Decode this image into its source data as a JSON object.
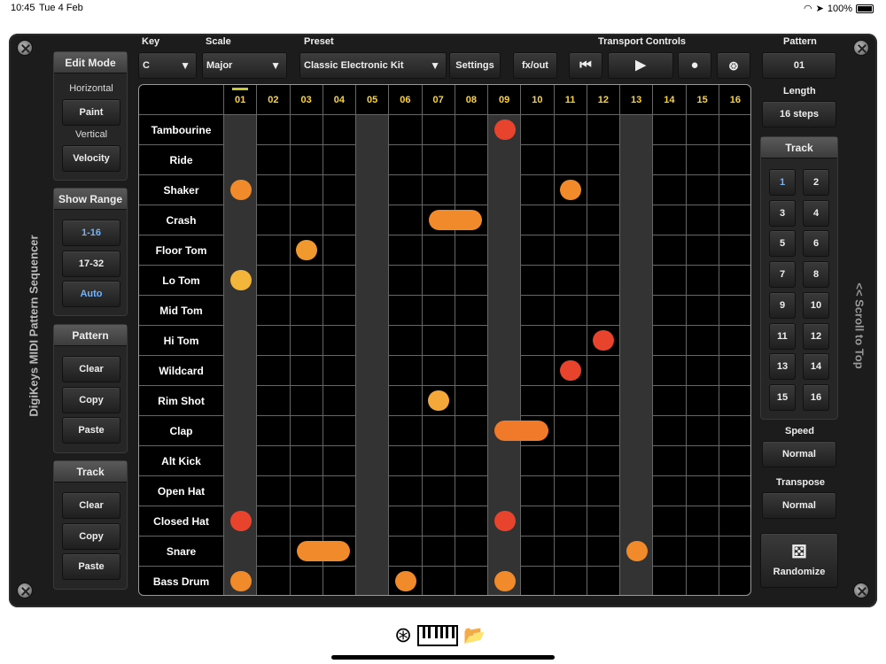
{
  "status": {
    "time": "10:45",
    "date": "Tue 4 Feb",
    "battery": "100%"
  },
  "app_title": "DigiKeys MIDI Pattern Sequencer",
  "scroll_hint": "<< Scroll to Top",
  "header": {
    "key_label": "Key",
    "key_value": "C",
    "scale_label": "Scale",
    "scale_value": "Major",
    "preset_label": "Preset",
    "preset_value": "Classic Electronic Kit",
    "settings": "Settings",
    "fxout": "fx/out",
    "transport_label": "Transport Controls",
    "pattern_label": "Pattern",
    "pattern_value": "01"
  },
  "left": {
    "edit_mode": {
      "title": "Edit Mode",
      "horizontal": "Horizontal",
      "paint": "Paint",
      "vertical": "Vertical",
      "velocity": "Velocity"
    },
    "show_range": {
      "title": "Show Range",
      "r1": "1-16",
      "r2": "17-32",
      "auto": "Auto"
    },
    "pattern": {
      "title": "Pattern",
      "clear": "Clear",
      "copy": "Copy",
      "paste": "Paste"
    },
    "track": {
      "title": "Track",
      "clear": "Clear",
      "copy": "Copy",
      "paste": "Paste"
    }
  },
  "right": {
    "length_label": "Length",
    "length_value": "16 steps",
    "track_title": "Track",
    "tracks": [
      "1",
      "2",
      "3",
      "4",
      "5",
      "6",
      "7",
      "8",
      "9",
      "10",
      "11",
      "12",
      "13",
      "14",
      "15",
      "16"
    ],
    "speed_label": "Speed",
    "speed_value": "Normal",
    "transpose_label": "Transpose",
    "transpose_value": "Normal",
    "randomize": "Randomize"
  },
  "columns": [
    "01",
    "02",
    "03",
    "04",
    "05",
    "06",
    "07",
    "08",
    "09",
    "10",
    "11",
    "12",
    "13",
    "14",
    "15",
    "16"
  ],
  "rows": [
    "Tambourine",
    "Ride",
    "Shaker",
    "Crash",
    "Floor Tom",
    "Lo Tom",
    "Mid Tom",
    "Hi Tom",
    "Wildcard",
    "Rim Shot",
    "Clap",
    "Alt Kick",
    "Open Hat",
    "Closed Hat",
    "Snare",
    "Bass Drum"
  ],
  "notes": [
    {
      "row": 0,
      "step": 9,
      "len": 1,
      "color": "#e8432c"
    },
    {
      "row": 2,
      "step": 1,
      "len": 1,
      "color": "#f08a2a"
    },
    {
      "row": 2,
      "step": 11,
      "len": 1,
      "color": "#f08a2a"
    },
    {
      "row": 3,
      "step": 7,
      "len": 2,
      "color": "#f08a2a"
    },
    {
      "row": 4,
      "step": 3,
      "len": 1,
      "color": "#f0992e"
    },
    {
      "row": 5,
      "step": 1,
      "len": 1,
      "color": "#f4b63a"
    },
    {
      "row": 7,
      "step": 12,
      "len": 1,
      "color": "#e8432c"
    },
    {
      "row": 8,
      "step": 11,
      "len": 1,
      "color": "#e8432c"
    },
    {
      "row": 9,
      "step": 7,
      "len": 1,
      "color": "#f4a83a"
    },
    {
      "row": 10,
      "step": 9,
      "len": 2,
      "color": "#f07a2a"
    },
    {
      "row": 13,
      "step": 1,
      "len": 1,
      "color": "#e8432c"
    },
    {
      "row": 13,
      "step": 9,
      "len": 1,
      "color": "#e8432c"
    },
    {
      "row": 14,
      "step": 3,
      "len": 2,
      "color": "#f08a2a"
    },
    {
      "row": 14,
      "step": 13,
      "len": 1,
      "color": "#f08a2a"
    },
    {
      "row": 15,
      "step": 1,
      "len": 1,
      "color": "#f08a2a"
    },
    {
      "row": 15,
      "step": 6,
      "len": 1,
      "color": "#f08a2a"
    },
    {
      "row": 15,
      "step": 9,
      "len": 1,
      "color": "#f08a2a"
    }
  ],
  "current_step": 1,
  "colors": {
    "column_header": "#ffd426",
    "selected_blue": "#6fb4ff"
  }
}
